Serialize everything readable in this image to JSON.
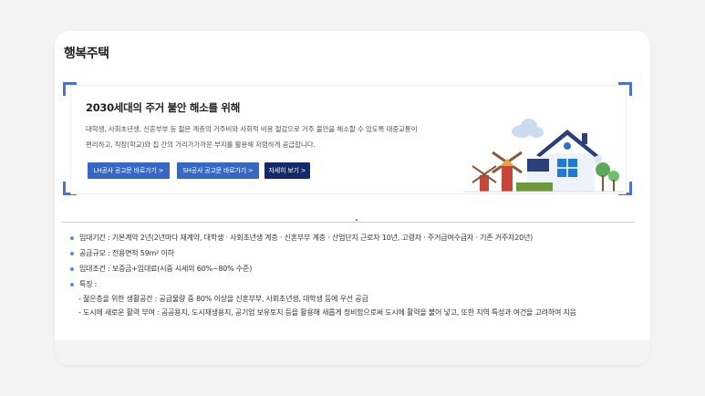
{
  "page_title": "행복주택",
  "banner": {
    "heading": "2030세대의 주거 불안 해소를 위해",
    "desc_line1": "대학생, 사회초년생, 신혼부부 등 젊은 계층의 거주비와 사회적 비용 절감으로 거주 불안을 해소할 수 있도록 대중교통이",
    "desc_line2": "편리하고, 직장(학교)와 집 간의 거리가가까운 부지를 활용해 저렴하게 공급합니다.",
    "buttons": {
      "lh": "LH공사 공고문 바로가기 >",
      "sh": "SH공사 공고문 바로가기 >",
      "more": "자세히 보기 >"
    }
  },
  "features": [
    {
      "label": "임대기간 : 기본계약 2년(2년마다 재계약, 대학생 · 사회초년생 계층 · 신혼부부 계층 · 산업단지 근로자 10년, 고령자 · 주거급여수급자 · 기존 거주자20년)"
    },
    {
      "label": "공급규모 : 전용면적 59m² 이하"
    },
    {
      "label": "임대조건 : 보증금+임대료(시중 시세의 60%~80% 수준)"
    },
    {
      "label": "특징 :"
    }
  ],
  "feature_details": [
    "- 젊은층을 위한 생활공간 : 공급물량 중 80% 이상을 신혼부부, 사회초년생, 대학생 등에 우선 공급",
    "- 도시에 새로운 활력 부여 : 공공용지, 도시재생용지, 공기업 보유토지 등을 활용해 새롭게 정비함으로써 도시에 활력을 불어 넣고, 또한 지역 특성과 여건을 고려하여 지음"
  ],
  "colors": {
    "accent": "#3667c4",
    "dark_button": "#13296b",
    "corner": "#4a72d6",
    "bullet": "#5b8de0"
  }
}
